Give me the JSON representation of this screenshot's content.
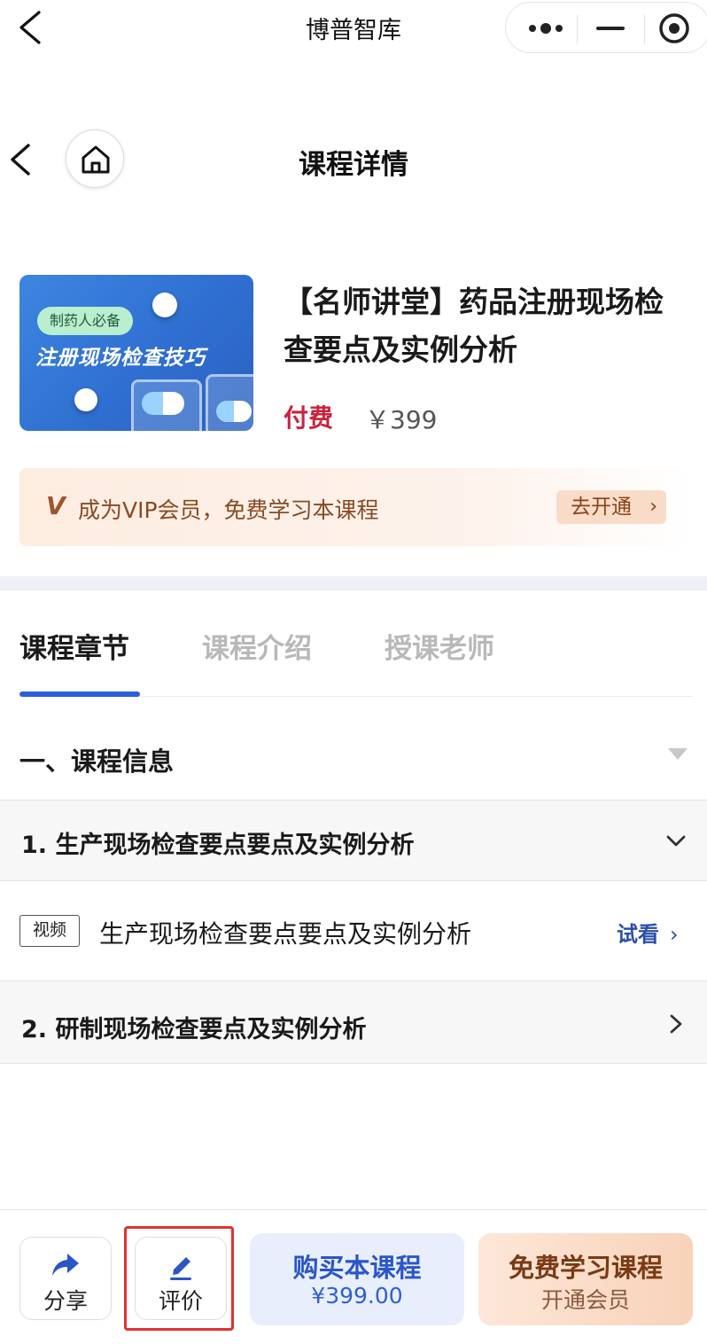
{
  "miniapp": {
    "title": "博普智库",
    "icons": {
      "back": "chevron-left-icon",
      "more": "more-dots-icon",
      "minimize": "minimize-icon",
      "close": "target-circle-icon"
    }
  },
  "page": {
    "title": "课程详情",
    "icons": {
      "back": "chevron-left-icon",
      "home": "home-icon"
    }
  },
  "course": {
    "cover": {
      "badge": "制药人必备",
      "title": "注册现场检查技巧"
    },
    "title": "【名师讲堂】药品注册现场检查要点及实例分析",
    "price_type": "付费",
    "price": "￥399"
  },
  "vip_banner": {
    "mark": "V",
    "text": "成为VIP会员，免费学习本课程",
    "button": "去开通",
    "button_chevron": "›"
  },
  "tabs": [
    {
      "label": "课程章节",
      "active": true
    },
    {
      "label": "课程介绍",
      "active": false
    },
    {
      "label": "授课老师",
      "active": false
    }
  ],
  "chapters": {
    "section_title": "一、课程信息",
    "items": [
      {
        "title": "1. 生产现场检查要点要点及实例分析",
        "expanded": true,
        "lessons": [
          {
            "type": "视频",
            "title": "生产现场检查要点要点及实例分析",
            "action": "试看",
            "action_chevron": "›"
          }
        ]
      },
      {
        "title": "2. 研制现场检查要点及实例分析",
        "expanded": false
      }
    ]
  },
  "bottom_bar": {
    "share": {
      "label": "分享",
      "icon": "share-arrow-icon"
    },
    "review": {
      "label": "评价",
      "icon": "pencil-icon"
    },
    "buy": {
      "label": "购买本课程",
      "price": "¥399.00"
    },
    "free": {
      "label": "免费学习课程",
      "sub": "开通会员"
    }
  },
  "colors": {
    "accent_blue": "#2a5fd8",
    "price_red": "#c8243f",
    "vip_brown": "#8a4a22",
    "highlight_red": "#e4312f"
  }
}
